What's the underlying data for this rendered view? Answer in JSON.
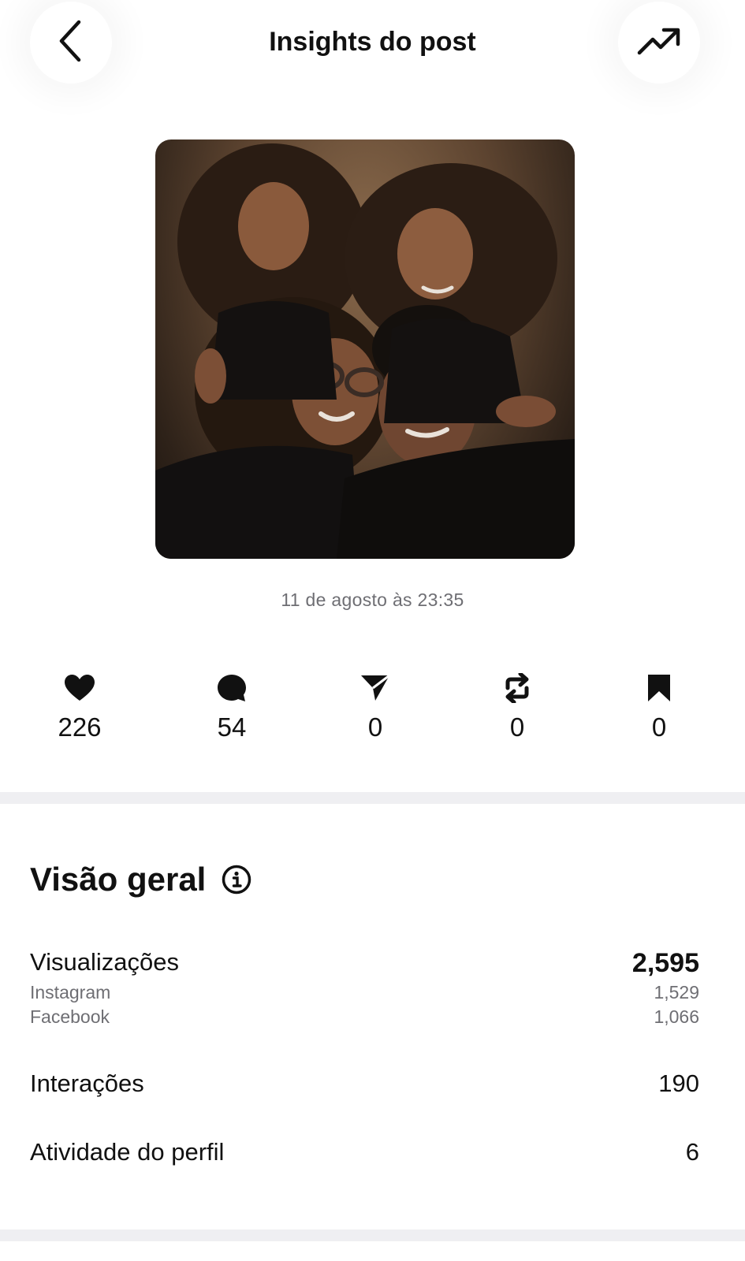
{
  "header": {
    "title": "Insights do post",
    "back_icon": "chevron-left-icon",
    "trend_icon": "trending-up-icon"
  },
  "post": {
    "image_alt": "Family portrait photo",
    "timestamp": "11 de agosto às 23:35"
  },
  "stats": [
    {
      "icon": "heart-icon",
      "value": "226"
    },
    {
      "icon": "comment-icon",
      "value": "54"
    },
    {
      "icon": "share-icon",
      "value": "0"
    },
    {
      "icon": "repost-icon",
      "value": "0"
    },
    {
      "icon": "bookmark-icon",
      "value": "0"
    }
  ],
  "overview": {
    "title": "Visão geral",
    "info_icon": "info-icon",
    "views": {
      "label": "Visualizações",
      "value": "2,595",
      "breakdown": [
        {
          "label": "Instagram",
          "value": "1,529"
        },
        {
          "label": "Facebook",
          "value": "1,066"
        }
      ]
    },
    "interactions": {
      "label": "Interações",
      "value": "190"
    },
    "profile_activity": {
      "label": "Atividade do perfil",
      "value": "6"
    }
  },
  "colors": {
    "text_primary": "#111111",
    "text_secondary": "#6e6e73",
    "divider": "#efeff2",
    "background": "#ffffff"
  }
}
